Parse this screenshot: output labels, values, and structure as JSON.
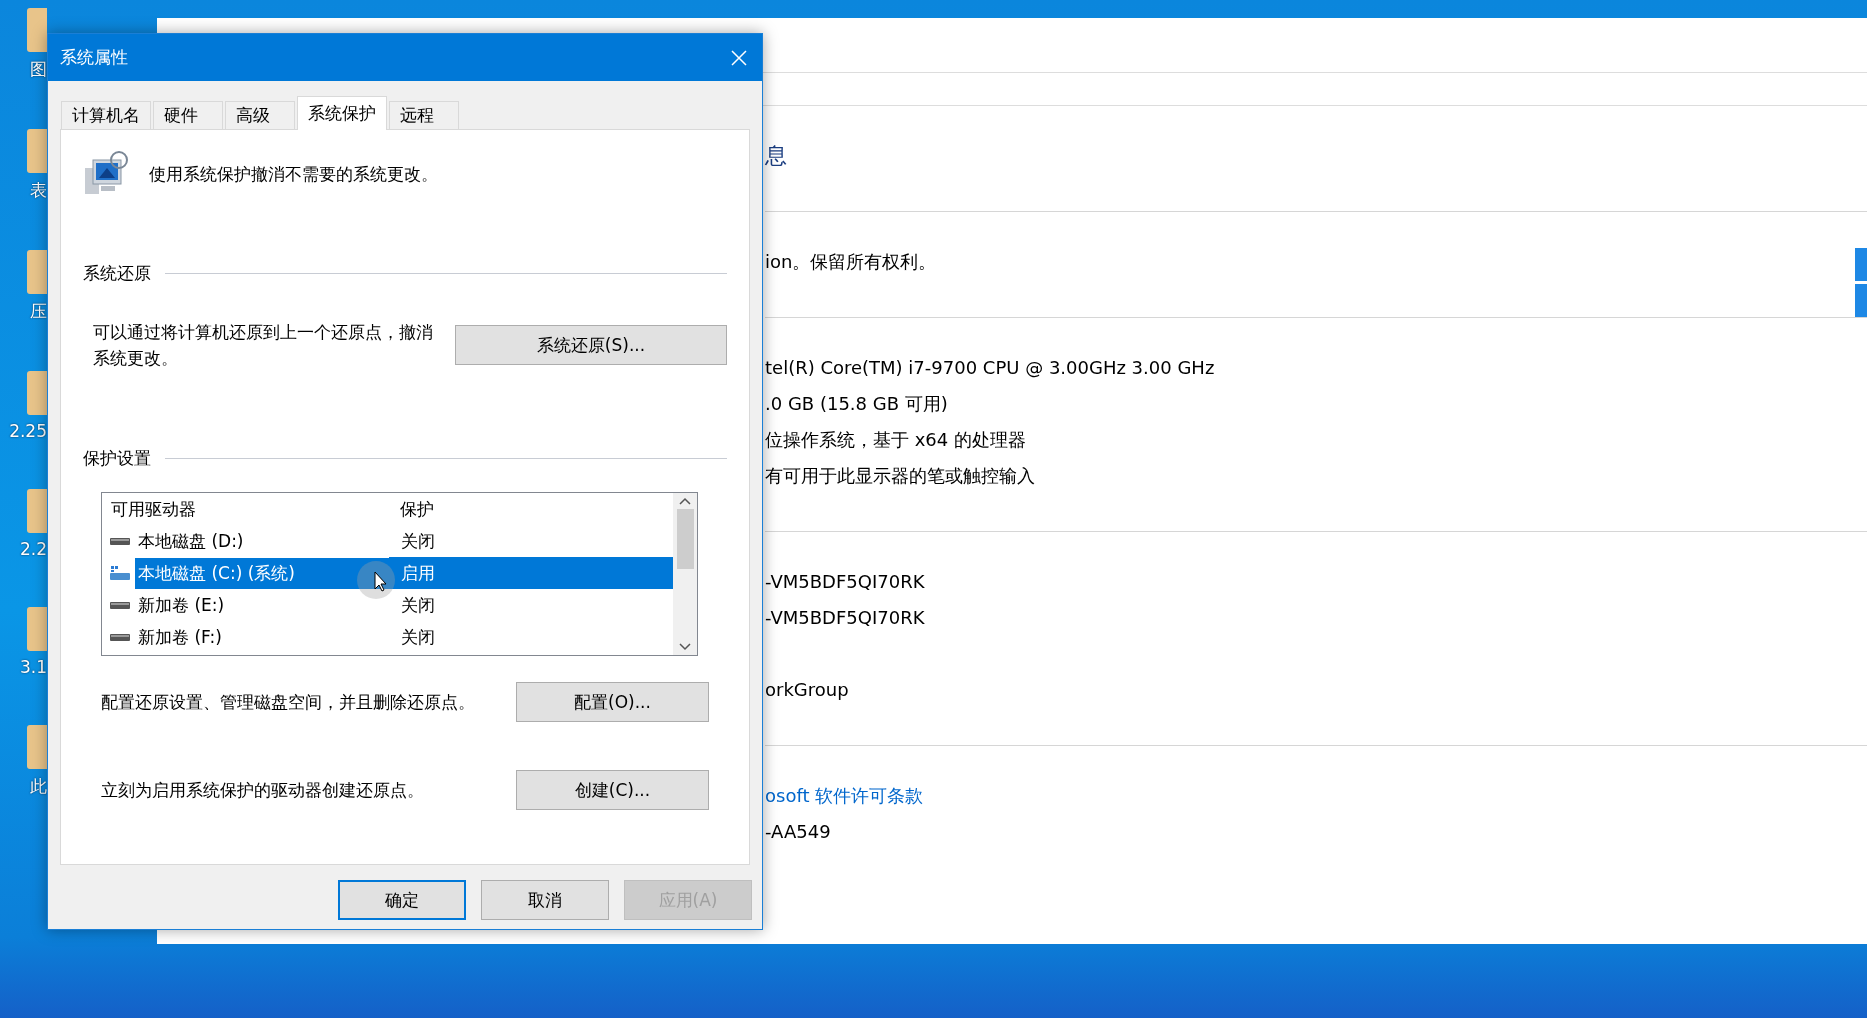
{
  "desktop": {
    "icons": [
      {
        "label": "图"
      },
      {
        "label": "表"
      },
      {
        "label": "压"
      },
      {
        "label": "2.25"
      },
      {
        "label": "2.2"
      },
      {
        "label": "3.1"
      },
      {
        "label": "此"
      }
    ]
  },
  "background_window": {
    "sections": [
      {
        "lines": [
          {
            "kind": "heading",
            "text": "息"
          }
        ]
      },
      {
        "lines": [
          {
            "kind": "text",
            "text": "ion。保留所有权利。"
          }
        ]
      },
      {
        "lines": [
          {
            "kind": "text",
            "text": "tel(R) Core(TM) i7-9700 CPU @ 3.00GHz   3.00 GHz"
          },
          {
            "kind": "text",
            "text": ".0 GB (15.8 GB 可用)"
          },
          {
            "kind": "text",
            "text": "位操作系统，基于 x64 的处理器"
          },
          {
            "kind": "text",
            "text": "有可用于此显示器的笔或触控输入"
          }
        ]
      },
      {
        "lines": [
          {
            "kind": "text",
            "text": "-VM5BDF5QI70RK"
          },
          {
            "kind": "text",
            "text": "-VM5BDF5QI70RK"
          },
          {
            "kind": "gap"
          },
          {
            "kind": "text",
            "text": "orkGroup"
          }
        ]
      },
      {
        "lines": [
          {
            "kind": "link",
            "text": "osoft 软件许可条款"
          },
          {
            "kind": "text",
            "text": "-AA549"
          }
        ]
      }
    ]
  },
  "dialog": {
    "title": "系统属性",
    "tabs": [
      {
        "label": "计算机名",
        "selected": false
      },
      {
        "label": "硬件",
        "selected": false
      },
      {
        "label": "高级",
        "selected": false
      },
      {
        "label": "系统保护",
        "selected": true
      },
      {
        "label": "远程",
        "selected": false
      }
    ],
    "description": "使用系统保护撤消不需要的系统更改。",
    "restore": {
      "group_label": "系统还原",
      "text": "可以通过将计算机还原到上一个还原点，撤消系统更改。",
      "button": "系统还原(S)..."
    },
    "protection": {
      "group_label": "保护设置",
      "columns": [
        "可用驱动器",
        "保护"
      ],
      "drives": [
        {
          "name": "本地磁盘 (D:)",
          "protection": "关闭",
          "kind": "local",
          "selected": false
        },
        {
          "name": "本地磁盘 (C:) (系统)",
          "protection": "启用",
          "kind": "system",
          "selected": true
        },
        {
          "name": "新加卷 (E:)",
          "protection": "关闭",
          "kind": "local",
          "selected": false
        },
        {
          "name": "新加卷 (F:)",
          "protection": "关闭",
          "kind": "local",
          "selected": false
        }
      ],
      "configure_text": "配置还原设置、管理磁盘空间，并且删除还原点。",
      "configure_button": "配置(O)...",
      "create_text": "立刻为启用系统保护的驱动器创建还原点。",
      "create_button": "创建(C)..."
    },
    "buttons": [
      {
        "label": "确定",
        "kind": "default"
      },
      {
        "label": "取消",
        "kind": "normal"
      },
      {
        "label": "应用(A)",
        "kind": "disabled"
      }
    ]
  }
}
